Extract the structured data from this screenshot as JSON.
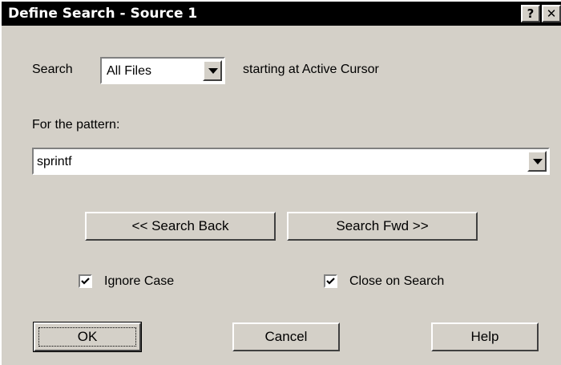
{
  "window": {
    "title": "Define Search - Source 1",
    "help_glyph": "?",
    "close_glyph": "✕"
  },
  "search_row": {
    "label": "Search",
    "scope_value": "All Files",
    "start_text": "starting at Active Cursor"
  },
  "pattern": {
    "label": "For the pattern:",
    "value": "sprintf"
  },
  "buttons": {
    "search_back": "<< Search Back",
    "search_fwd": "Search Fwd >>",
    "ok": "OK",
    "cancel": "Cancel",
    "help": "Help"
  },
  "options": {
    "ignore_case": {
      "label": "Ignore Case",
      "checked": true
    },
    "close_on_search": {
      "label": "Close on Search",
      "checked": true
    }
  },
  "colors": {
    "dialog_bg": "#d4d0c8",
    "titlebar_bg": "#000000",
    "titlebar_text": "#ffffff"
  },
  "icons": {
    "dropdown": "chevron-down-icon",
    "check": "checkmark-icon"
  }
}
